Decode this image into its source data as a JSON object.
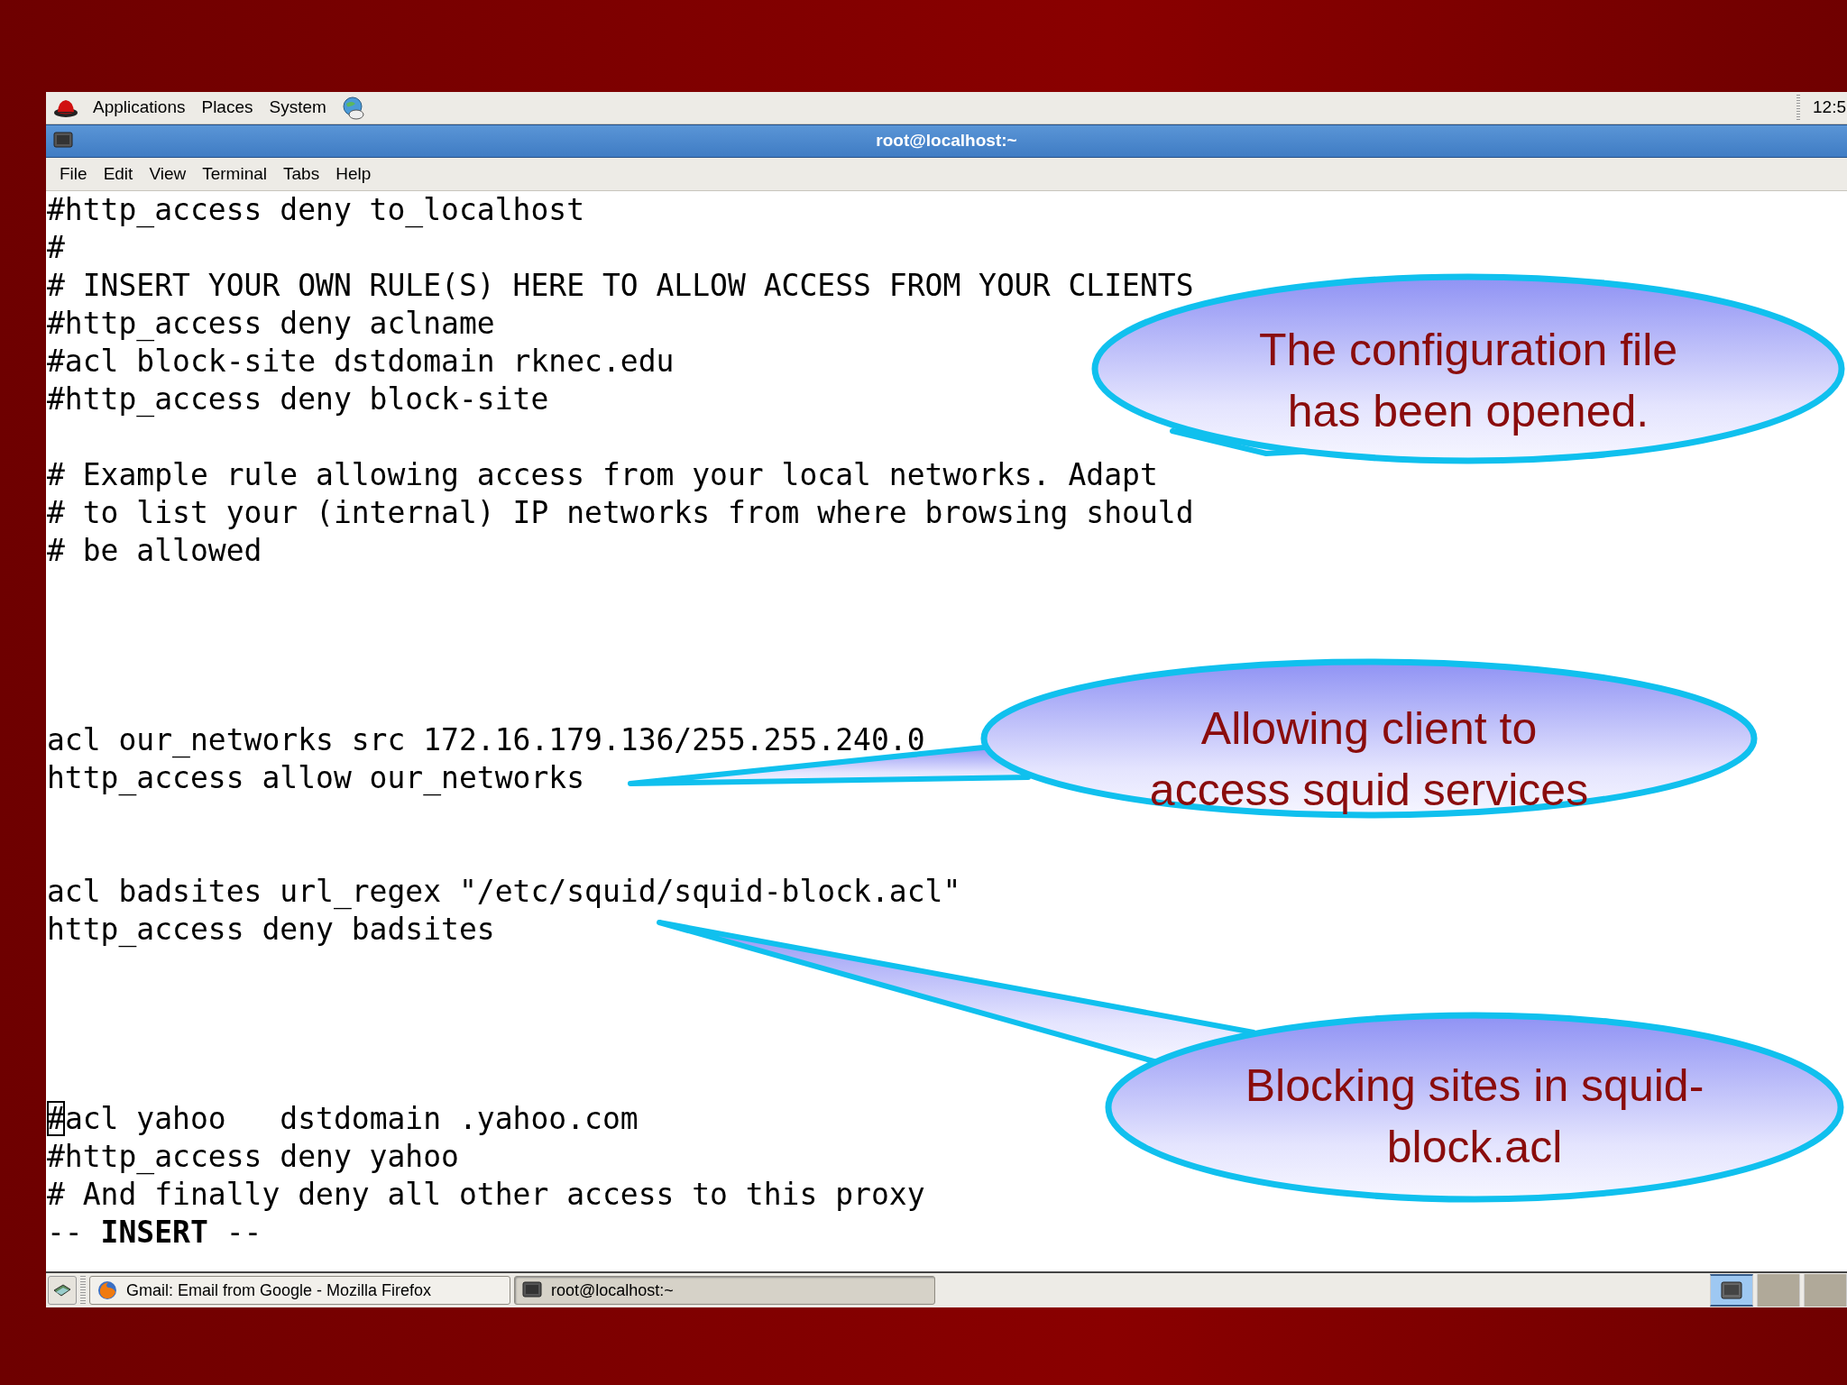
{
  "top_panel": {
    "menus": [
      "Applications",
      "Places",
      "System"
    ],
    "clock": "12:5"
  },
  "window": {
    "title": "root@localhost:~"
  },
  "menu_bar": [
    {
      "label": "File"
    },
    {
      "label": "Edit"
    },
    {
      "label": "View"
    },
    {
      "label": "Terminal"
    },
    {
      "label": "Tabs"
    },
    {
      "label": "Help"
    }
  ],
  "terminal": {
    "blocks": [
      {
        "lines": [
          {
            "text": "#http_access deny to_localhost"
          },
          {
            "text": "#"
          },
          {
            "text": "# INSERT YOUR OWN RULE(S) HERE TO ALLOW ACCESS FROM YOUR CLIENTS"
          },
          {
            "text": "#http_access deny aclname"
          },
          {
            "text": "#acl block-site dstdomain rknec.edu"
          },
          {
            "text": "#http_access deny block-site"
          }
        ]
      },
      {
        "lines": [
          {
            "text": "# Example rule allowing access from your local networks. Adapt"
          },
          {
            "text": "# to list your (internal) IP networks from where browsing should"
          },
          {
            "text": "# be allowed"
          }
        ]
      },
      {
        "lines": [
          {
            "text": "acl our_networks src 172.16.179.136/255.255.240.0"
          },
          {
            "text": "http_access allow our_networks"
          }
        ]
      },
      {
        "lines": [
          {
            "text": "acl badsites url_regex \"/etc/squid/squid-block.acl\""
          },
          {
            "text": "http_access deny badsites"
          }
        ]
      },
      {
        "lines": [
          {
            "text": "#acl yahoo   dstdomain .yahoo.com",
            "cursor": true
          },
          {
            "text": "#http_access deny yahoo"
          },
          {
            "text": "# And finally deny all other access to this proxy"
          },
          {
            "text": "-- **INSERT** --"
          }
        ]
      }
    ]
  },
  "callouts": [
    {
      "lines": [
        "The configuration file",
        "has been opened."
      ]
    },
    {
      "lines": [
        "Allowing client to",
        "access squid services"
      ]
    },
    {
      "lines": [
        "Blocking sites in squid-",
        "block.acl"
      ]
    }
  ],
  "taskbar": {
    "tasks": [
      {
        "kind": "browser",
        "label": "Gmail: Email from Google - Mozilla Firefox",
        "selected": false
      },
      {
        "kind": "terminal",
        "label": "root@localhost:~",
        "selected": true
      }
    ],
    "workspaces": [
      {
        "selected": true
      },
      {
        "selected": false
      },
      {
        "selected": false
      }
    ]
  }
}
